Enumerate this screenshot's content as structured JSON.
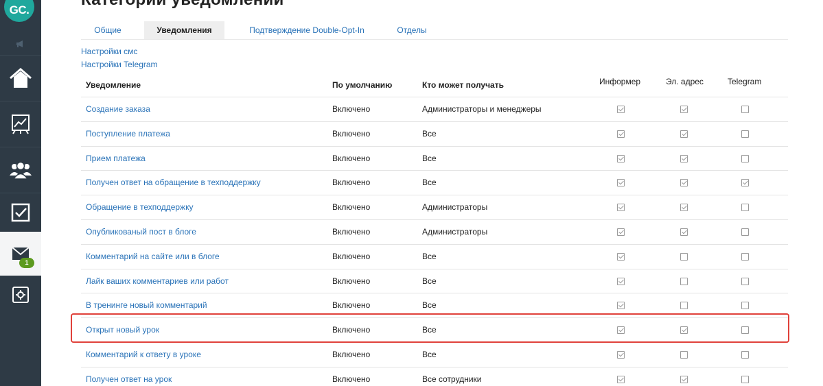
{
  "logo": {
    "text": "GC."
  },
  "sidebar": {
    "items": [
      {
        "icon": "megaphone-icon"
      },
      {
        "icon": "home-icon"
      },
      {
        "icon": "chart-icon"
      },
      {
        "icon": "users-icon"
      },
      {
        "icon": "checkbox-icon"
      },
      {
        "icon": "mail-icon",
        "badge": "1",
        "active": true
      },
      {
        "icon": "settings-icon"
      }
    ]
  },
  "header": {
    "title": "Категории уведомлений"
  },
  "tabs": [
    {
      "label": "Общие"
    },
    {
      "label": "Уведомления",
      "active": true
    },
    {
      "label": "Подтверждение Double-Opt-In"
    },
    {
      "label": "Отделы"
    }
  ],
  "links": {
    "sms": "Настройки смс",
    "telegram": "Настройки Telegram"
  },
  "table": {
    "headers": {
      "notification": "Уведомление",
      "default": "По умолчанию",
      "who": "Кто может получать",
      "informer": "Информер",
      "email": "Эл. адрес",
      "telegram": "Telegram"
    },
    "rows": [
      {
        "name": "Создание заказа",
        "default": "Включено",
        "who": "Администраторы и менеджеры",
        "informer": true,
        "email": true,
        "telegram": false
      },
      {
        "name": "Поступление платежа",
        "default": "Включено",
        "who": "Все",
        "informer": true,
        "email": true,
        "telegram": false
      },
      {
        "name": "Прием платежа",
        "default": "Включено",
        "who": "Все",
        "informer": true,
        "email": true,
        "telegram": false
      },
      {
        "name": "Получен ответ на обращение в техподдержку",
        "default": "Включено",
        "who": "Все",
        "informer": true,
        "email": true,
        "telegram": true
      },
      {
        "name": "Обращение в техподдержку",
        "default": "Включено",
        "who": "Администраторы",
        "informer": true,
        "email": true,
        "telegram": false
      },
      {
        "name": "Опубликованый пост в блоге",
        "default": "Включено",
        "who": "Администраторы",
        "informer": true,
        "email": true,
        "telegram": false
      },
      {
        "name": "Комментарий на сайте или в блоге",
        "default": "Включено",
        "who": "Все",
        "informer": true,
        "email": false,
        "telegram": false
      },
      {
        "name": "Лайк ваших комментариев или работ",
        "default": "Включено",
        "who": "Все",
        "informer": true,
        "email": false,
        "telegram": false
      },
      {
        "name": "В тренинге новый комментарий",
        "default": "Включено",
        "who": "Все",
        "informer": true,
        "email": false,
        "telegram": false
      },
      {
        "name": "Открыт новый урок",
        "default": "Включено",
        "who": "Все",
        "informer": true,
        "email": true,
        "telegram": false,
        "highlighted": true
      },
      {
        "name": "Комментарий к ответу в уроке",
        "default": "Включено",
        "who": "Все",
        "informer": true,
        "email": false,
        "telegram": false
      },
      {
        "name": "Получен ответ на урок",
        "default": "Включено",
        "who": "Все сотрудники",
        "informer": true,
        "email": true,
        "telegram": false
      }
    ]
  },
  "colors": {
    "sidebar": "#2e3a45",
    "accent": "#1fa89d",
    "link": "#2a73b8",
    "highlight": "#e0413a",
    "badge": "#5c9a1f"
  }
}
